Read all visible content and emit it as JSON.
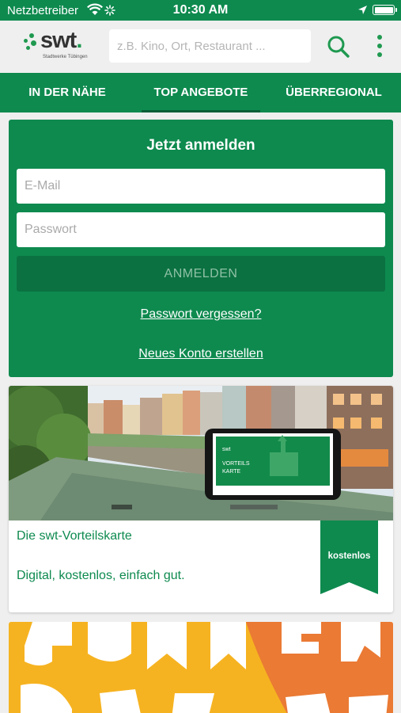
{
  "status_bar": {
    "carrier": "Netzbetreiber",
    "time": "10:30 AM"
  },
  "header": {
    "logo_text": "swt",
    "logo_subtext": "Stadtwerke Tübingen",
    "search_placeholder": "z.B. Kino, Ort, Restaurant ...",
    "search_value": ""
  },
  "tabs": [
    {
      "label": "IN DER NÄHE",
      "active": false
    },
    {
      "label": "TOP ANGEBOTE",
      "active": true
    },
    {
      "label": "ÜBERREGIONAL",
      "active": false
    }
  ],
  "login": {
    "title": "Jetzt anmelden",
    "email_placeholder": "E-Mail",
    "email_value": "",
    "password_placeholder": "Passwort",
    "password_value": "",
    "submit_label": "ANMELDEN",
    "forgot_label": "Passwort vergessen?",
    "register_label": "Neues Konto erstellen"
  },
  "offer": {
    "title": "Die swt-Vorteilskarte",
    "description": "Digital, kostenlos, einfach gut.",
    "badge": "kostenlos",
    "card_brand": "swt",
    "card_line1": "VORTEILS",
    "card_line2": "KARTE"
  },
  "colors": {
    "primary_green": "#0e8a4f",
    "dark_green": "#0b5e37",
    "button_green": "#0b7140",
    "background": "#efefef"
  }
}
